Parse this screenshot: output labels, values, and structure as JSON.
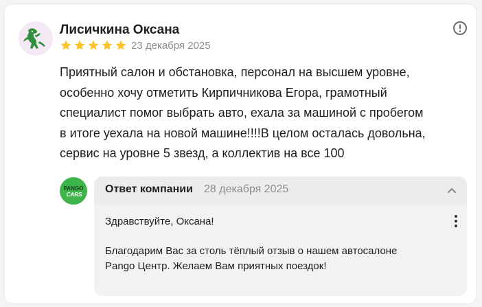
{
  "review": {
    "author": "Лисичкина Оксана",
    "rating": 5,
    "date": "23 декабря 2025",
    "text_lines": [
      "Приятный салон и обстановка, персонал на высшем уровне,",
      "особенно хочу отметить Кирпичникова Егора, грамотный",
      "специалист помог выбрать авто, ехала за машиной с пробегом",
      "в итоге уехала на новой машине!!!!В целом осталась довольна,",
      "сервис на уровне 5 звезд, а коллектив на все 100"
    ],
    "avatar_icon": "dinosaur-icon",
    "report_icon": "exclamation-circle-icon"
  },
  "reply": {
    "label": "Ответ компании",
    "date": "28 декабря 2025",
    "logo_line1": "PANGO",
    "logo_line2": "CARS",
    "greeting": "Здравствуйте, Оксана!",
    "text_lines": [
      "Благодарим Вас за столь тёплый отзыв о нашем автосалоне",
      "Pango Центр. Желаем Вам приятных поездок!"
    ],
    "collapse_icon": "chevron-up-icon",
    "menu_icon": "more-vertical-icon"
  },
  "colors": {
    "star": "#fcc42c",
    "logo_green": "#3eb54a",
    "muted_text": "#8c8c8c"
  }
}
